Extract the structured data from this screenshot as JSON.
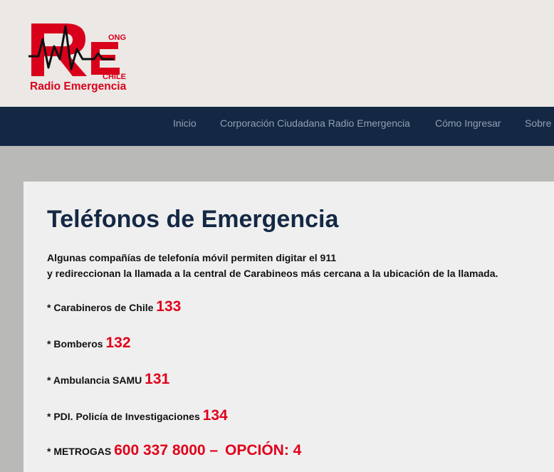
{
  "logo": {
    "ong": "ONG",
    "chile": "CHILE",
    "name": "Radio Emergencia",
    "brand_color": "#d9001b"
  },
  "nav": {
    "items": [
      {
        "label": "Inicio"
      },
      {
        "label": "Corporación Ciudadana Radio Emergencia"
      },
      {
        "label": "Cómo Ingresar"
      },
      {
        "label": "Sobre"
      }
    ],
    "background": "#142844"
  },
  "page": {
    "title": "Teléfonos de Emergencia",
    "intro_line1": "Algunas compañías de telefonía móvil permiten digitar el 911",
    "intro_line2": "y redireccionan la llamada a la central de Carabineos más cercana a la ubicación de la llamada.",
    "numbers": [
      {
        "label": "* Carabineros de Chile",
        "number": "133"
      },
      {
        "label": "* Bomberos",
        "number": "132"
      },
      {
        "label": "* Ambulancia SAMU",
        "number": "131"
      },
      {
        "label": "* PDI. Policía de Investigaciones",
        "number": "134"
      },
      {
        "label": "* METROGAS",
        "number": "600 337 8000 –",
        "option": "OPCIÓN: 4"
      }
    ],
    "accent_color": "#e0001b"
  }
}
